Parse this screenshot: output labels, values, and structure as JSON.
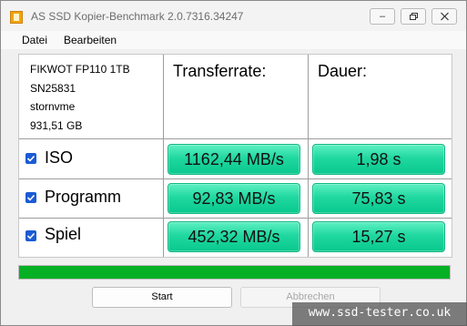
{
  "window": {
    "title": "AS SSD Kopier-Benchmark 2.0.7316.34247",
    "minimize_glyph": "–"
  },
  "menu": {
    "file": "Datei",
    "edit": "Bearbeiten"
  },
  "drive": {
    "model": "FIKWOT FP110 1TB",
    "serial": "SN25831",
    "driver": "stornvme",
    "capacity": "931,51 GB"
  },
  "columns": {
    "transfer": "Transferrate:",
    "duration": "Dauer:"
  },
  "rows": [
    {
      "label": "ISO",
      "checked": true,
      "transfer": "1162,44 MB/s",
      "duration": "1,98 s"
    },
    {
      "label": "Programm",
      "checked": true,
      "transfer": "92,83 MB/s",
      "duration": "75,83 s"
    },
    {
      "label": "Spiel",
      "checked": true,
      "transfer": "452,32 MB/s",
      "duration": "15,27 s"
    }
  ],
  "progress": {
    "fraction": 1.0,
    "color": "#06b025"
  },
  "buttons": {
    "start": "Start",
    "abort": "Abbrechen"
  },
  "watermark": "www.ssd-tester.co.uk",
  "colors": {
    "result_green": "#20d8a0",
    "checkbox_blue": "#1b5bd4"
  }
}
